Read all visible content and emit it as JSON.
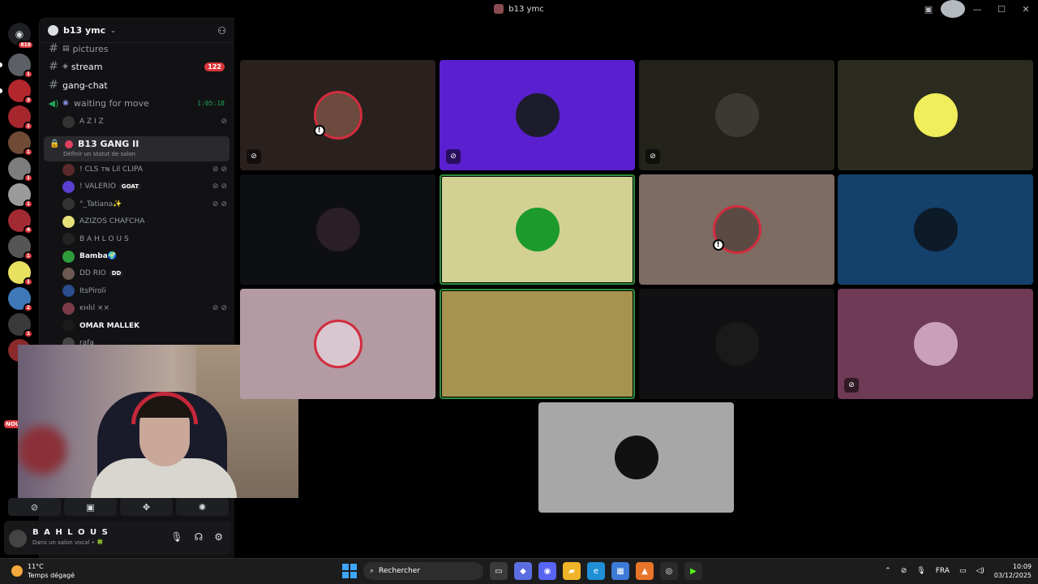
{
  "window": {
    "title": "b13 ymc"
  },
  "server": {
    "name": "b13 ymc"
  },
  "rail": {
    "top_badge": "818",
    "servers": [
      {
        "color": "#5c5f66",
        "badge": "1"
      },
      {
        "color": "#b3262e",
        "badge": "3"
      },
      {
        "color": "#a6262d",
        "badge": "1"
      },
      {
        "color": "#6f4a35",
        "badge": "1"
      },
      {
        "color": "#7d7d7d",
        "badge": "1"
      },
      {
        "color": "#9b9b9b",
        "badge": "1"
      },
      {
        "color": "#a22a33",
        "badge": "4"
      },
      {
        "color": "#555555",
        "badge": "1"
      },
      {
        "color": "#e8e060",
        "badge": "1"
      },
      {
        "color": "#3e78b8",
        "badge": "2"
      },
      {
        "color": "#3a3a3a",
        "badge": "1"
      },
      {
        "color": "#8a2a2a",
        "badge": ""
      }
    ],
    "new_label": "NOU"
  },
  "channels": {
    "pictures": "pictures",
    "stream": "stream",
    "stream_count": "122",
    "gang_chat": "gang-chat",
    "waiting": "waiting for move",
    "waiting_time": "1:05:18",
    "aziz": "A Z I Z"
  },
  "active_vc": {
    "name": "B13 GANG II",
    "status": "Définir un statut de salon"
  },
  "members": [
    {
      "name": "! CLS ᴛɴ Lil CLIPA",
      "color": "#5a2a2a",
      "icons": "⊘⊘",
      "bright": false
    },
    {
      "name": "! VALERIO",
      "color": "#5b3fd1",
      "icons": "⊘⊘",
      "bright": false,
      "tag": "GOAT"
    },
    {
      "name": "°_Tatiana✨",
      "color": "#333333",
      "icons": "⊘⊘",
      "bright": false
    },
    {
      "name": "AZIZOS CHAFCHA",
      "color": "#e6e07a",
      "icons": "",
      "bright": false
    },
    {
      "name": "B A H L O U S",
      "color": "#222222",
      "icons": "",
      "bright": false
    },
    {
      "name": "Bamba🌍",
      "color": "#2e9c3a",
      "icons": "",
      "bright": true
    },
    {
      "name": "DD RIO",
      "color": "#6d5a52",
      "icons": "",
      "bright": false,
      "tag": "DD"
    },
    {
      "name": "ItsPiroli",
      "color": "#2c4d8c",
      "icons": "",
      "bright": false
    },
    {
      "name": "ĸнlιl ××",
      "color": "#7a3a4a",
      "icons": "⊘⊘",
      "bright": false
    },
    {
      "name": "OMAR MALLEK",
      "color": "#1b1b1b",
      "icons": "",
      "bright": true
    },
    {
      "name": "rafa",
      "color": "#444444",
      "icons": "",
      "bright": false
    }
  ],
  "controls": [
    "⊘",
    "▣",
    "✥",
    "✺"
  ],
  "user": {
    "name": "B A H L O U S",
    "status": "Dans un salon vocal • 🍀"
  },
  "tiles": [
    {
      "bg": "#2a211e",
      "av": "#6d4a3e",
      "muted": true,
      "warn": true,
      "ring": true,
      "speaking": false
    },
    {
      "bg": "#5a1fcf",
      "av": "#1d1c2c",
      "muted": true,
      "warn": false,
      "ring": false,
      "speaking": false
    },
    {
      "bg": "#23231c",
      "av": "#3b3a32",
      "muted": true,
      "warn": false,
      "ring": false,
      "speaking": false
    },
    {
      "bg": "#2c2b20",
      "av": "#f0ee5a",
      "muted": false,
      "warn": false,
      "ring": false,
      "speaking": false
    },
    {
      "bg": "#0e0f12",
      "av": "#2a1f24",
      "muted": false,
      "warn": false,
      "ring": false,
      "speaking": false
    },
    {
      "bg": "#d2d092",
      "av": "#1c9a2c",
      "muted": false,
      "warn": false,
      "ring": false,
      "speaking": true
    },
    {
      "bg": "#7e6b62",
      "av": "#5b4a44",
      "muted": false,
      "warn": true,
      "ring": true,
      "speaking": false
    },
    {
      "bg": "#13416b",
      "av": "#0d1a28",
      "muted": false,
      "warn": false,
      "ring": false,
      "speaking": false
    },
    {
      "bg": "#b49aa2",
      "av": "#d9c7cf",
      "muted": false,
      "warn": false,
      "ring": true,
      "speaking": false
    },
    {
      "bg": "#a79350",
      "av": "#a79350",
      "muted": false,
      "warn": false,
      "ring": false,
      "speaking": true
    },
    {
      "bg": "#111114",
      "av": "#1a1a1a",
      "muted": false,
      "warn": false,
      "ring": false,
      "speaking": false
    },
    {
      "bg": "#6e3a55",
      "av": "#c9a0b8",
      "muted": true,
      "warn": false,
      "ring": false,
      "speaking": false
    },
    {
      "bg": "#a7a7a7",
      "av": "#111111",
      "muted": false,
      "warn": false,
      "ring": false,
      "speaking": false
    }
  ],
  "taskbar": {
    "temp": "11°C",
    "weather": "Temps dégagé",
    "search": "Rechercher",
    "lang": "FRA",
    "time": "10:09",
    "date": "03/12/2025"
  }
}
